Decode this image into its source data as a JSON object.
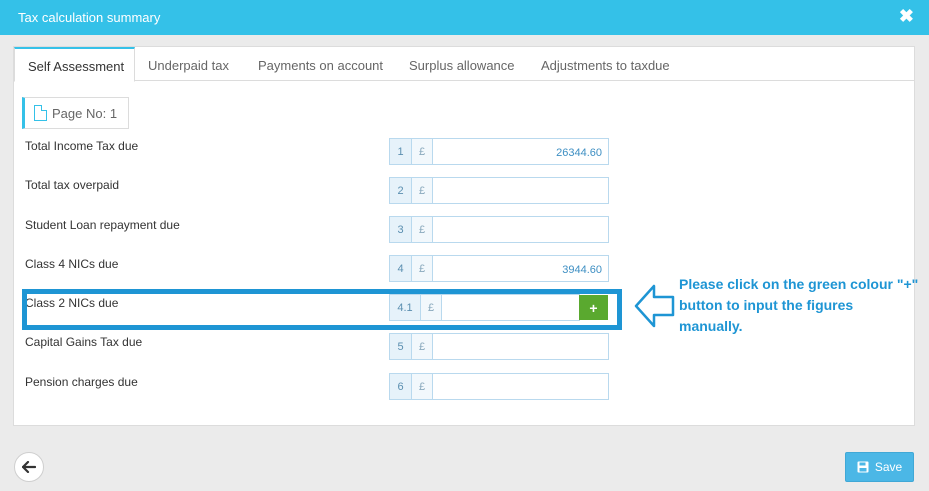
{
  "window": {
    "title": "Tax calculation summary",
    "close_symbol": "✖"
  },
  "tabs": [
    {
      "label": "Self Assessment",
      "active": true
    },
    {
      "label": "Underpaid tax",
      "active": false
    },
    {
      "label": "Payments on account",
      "active": false
    },
    {
      "label": "Surplus allowance",
      "active": false
    },
    {
      "label": "Adjustments to taxdue",
      "active": false
    }
  ],
  "page_no": "Page No: 1",
  "rows": [
    {
      "label": "Total Income Tax due",
      "num": "1",
      "currency": "£",
      "value": "26344.60"
    },
    {
      "label": "Total tax overpaid",
      "num": "2",
      "currency": "£",
      "value": ""
    },
    {
      "label": "Student Loan repayment due",
      "num": "3",
      "currency": "£",
      "value": ""
    },
    {
      "label": "Class 4 NICs due",
      "num": "4",
      "currency": "£",
      "value": "3944.60"
    },
    {
      "label": "Class 2 NICs due",
      "num": "4.1",
      "currency": "£",
      "value": ""
    },
    {
      "label": "Capital Gains Tax due",
      "num": "5",
      "currency": "£",
      "value": ""
    },
    {
      "label": "Pension charges due",
      "num": "6",
      "currency": "£",
      "value": ""
    }
  ],
  "plus_button": {
    "symbol": "+"
  },
  "annotation": {
    "note": "Please click on the green colour \"+\" button to input the figures manually."
  },
  "footer": {
    "save_label": "Save"
  },
  "colors": {
    "accent": "#34c1e8",
    "green": "#5aa92f",
    "annotation": "#1e95d4"
  },
  "icons": {
    "close": "close-icon",
    "page": "document-icon",
    "back": "arrow-left-icon",
    "save": "floppy-disk-icon"
  }
}
